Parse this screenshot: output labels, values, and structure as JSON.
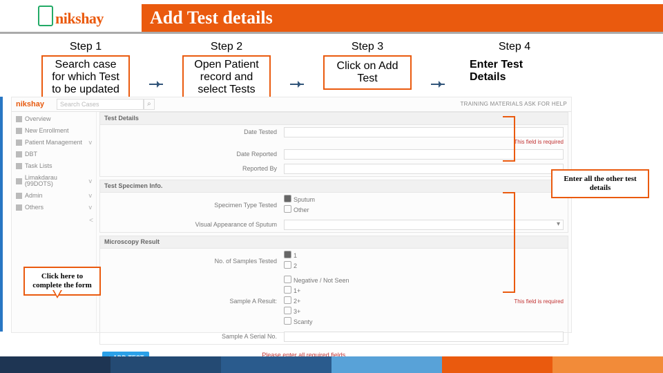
{
  "header": {
    "logo_text": "nikshay",
    "title": "Add Test details"
  },
  "steps": [
    {
      "label": "Step 1",
      "text": "Search case for which Test to be updated"
    },
    {
      "label": "Step 2",
      "text": "Open Patient record and select Tests section"
    },
    {
      "label": "Step 3",
      "text": "Click on Add Test"
    },
    {
      "label": "Step 4",
      "text": "Enter Test Details"
    }
  ],
  "screenshot": {
    "mini_logo": "nikshay",
    "search_placeholder": "Search Cases",
    "top_links": "TRAINING MATERIALS    ASK FOR HELP",
    "sidebar": [
      {
        "label": "Overview"
      },
      {
        "label": "New Enrollment"
      },
      {
        "label": "Patient Management",
        "caret": "v"
      },
      {
        "label": "DBT"
      },
      {
        "label": "Task Lists"
      },
      {
        "label": "Limakdarau (99DOTS)",
        "caret": "v"
      },
      {
        "label": "Admin",
        "caret": "v"
      },
      {
        "label": "Others",
        "caret": "v"
      }
    ],
    "panels": {
      "test_details": {
        "title": "Test Details",
        "rows": [
          "Date Tested",
          "Date Reported",
          "Reported By"
        ],
        "error": "This field is required"
      },
      "specimen": {
        "title": "Test Specimen Info.",
        "type_label": "Specimen Type Tested",
        "type_options": [
          "Sputum",
          "Other"
        ],
        "visual_label": "Visual Appearance of Sputum"
      },
      "microscopy": {
        "title": "Microscopy Result",
        "samples_label": "No. of Samples Tested",
        "samples_options": [
          "1",
          "2"
        ],
        "resultA_label": "Sample A Result:",
        "resultA_options": [
          "Negative / Not Seen",
          "1+",
          "2+",
          "3+",
          "Scanty"
        ],
        "error": "This field is required",
        "serial_label": "Sample A Serial No."
      }
    },
    "add_button": "+ ADD TEST",
    "required_msg": "Please enter all required fields."
  },
  "callouts": {
    "complete": "Click here to complete the form",
    "enter_other": "Enter all the other test details"
  },
  "colors": {
    "accent": "#ea5a0e",
    "blue": "#2aa0e8",
    "error": "#c03030"
  }
}
